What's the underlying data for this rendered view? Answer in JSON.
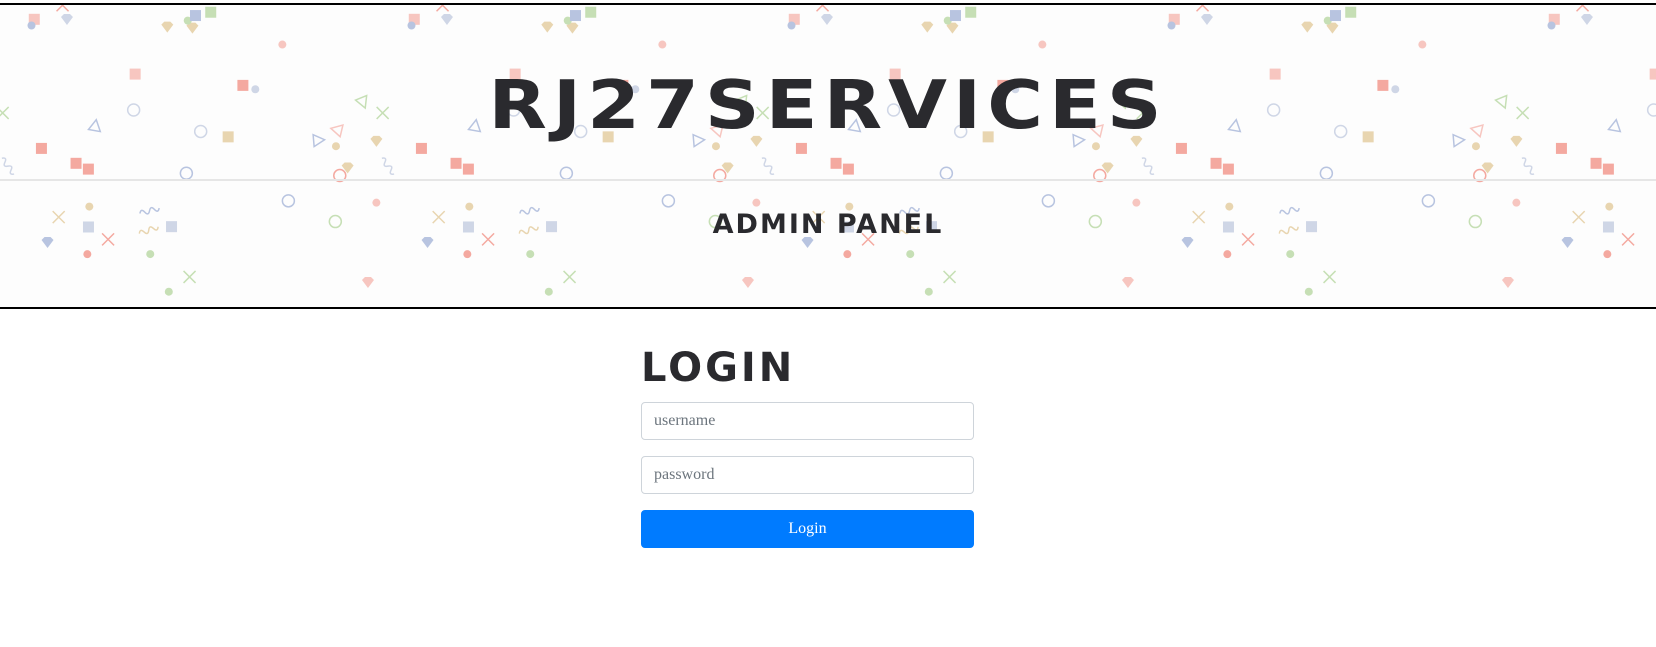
{
  "header": {
    "title": "RJ27SERVICES",
    "subtitle": "ADMIN PANEL"
  },
  "login": {
    "title": "LOGIN",
    "username_placeholder": "username",
    "password_placeholder": "password",
    "button_label": "Login"
  },
  "colors": {
    "primary": "#007bff",
    "heading": "#2a2a2e"
  }
}
